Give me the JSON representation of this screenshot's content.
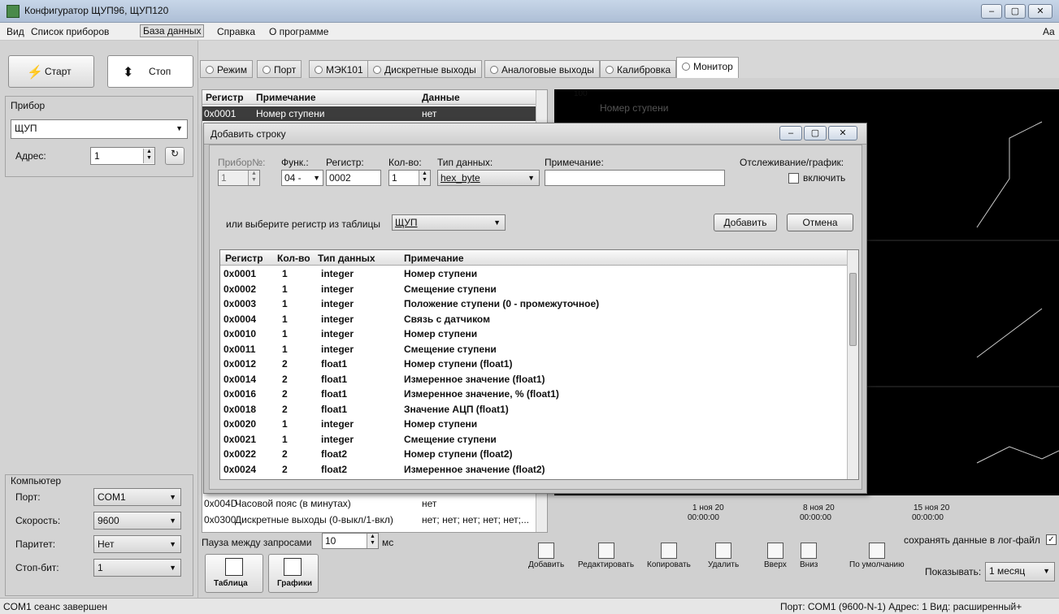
{
  "window": {
    "title": "Конфигуратор ЩУП96, ЩУП120",
    "min": "–",
    "max": "▢",
    "close": "✕"
  },
  "menu": {
    "items": [
      "Вид",
      "Список приборов",
      "База данных",
      "Справка",
      "О программе"
    ],
    "right": "Aa"
  },
  "controls": {
    "start_label": "Старт",
    "stop_label": "Стоп"
  },
  "device": {
    "group_label": "Прибор",
    "device_value": "ЩУП",
    "address_label": "Адрес:",
    "address_value": "1"
  },
  "computer": {
    "group_label": "Компьютер",
    "port_label": "Порт:",
    "port_value": "COM1",
    "speed_label": "Скорость:",
    "speed_value": "9600",
    "parity_label": "Паритет:",
    "parity_value": "Нет",
    "stopbit_label": "Стоп-бит:",
    "stopbit_value": "1"
  },
  "tabs": [
    "Режим",
    "Порт",
    "МЭК101",
    "Дискретные выходы",
    "Аналоговые выходы",
    "Калибровка",
    "Монитор"
  ],
  "active_tab": "Монитор",
  "reg_table": {
    "headers": [
      "Регистр",
      "Примечание",
      "Данные"
    ],
    "rows": [
      {
        "reg": "0x0001",
        "note": "Номер ступени",
        "data": "нет"
      },
      {
        "reg": "0x004D",
        "note": "Часовой пояс (в минутах)",
        "data": "нет"
      },
      {
        "reg": "0x0300",
        "note": "Дискретные выходы (0-выкл/1-вкл)",
        "data": "нет; нет; нет; нет; нет;..."
      }
    ]
  },
  "monitor": {
    "top_tick": "100",
    "chart_label": "Номер ступени",
    "x_ticks": [
      {
        "date": "1 ноя 20",
        "time": "00:00:00"
      },
      {
        "date": "8 ноя 20",
        "time": "00:00:00"
      },
      {
        "date": "15 ноя 20",
        "time": "00:00:00"
      }
    ]
  },
  "pause": {
    "label": "Пауза между запросами",
    "value": "10",
    "unit": "мс"
  },
  "log": {
    "label": "сохранять данные в лог-файл",
    "checked": true
  },
  "view_buttons": {
    "table": "Таблица",
    "charts": "Графики"
  },
  "toolbar": {
    "add": "Добавить",
    "edit": "Редактировать",
    "copy": "Копировать",
    "delete": "Удалить",
    "up": "Вверх",
    "down": "Вниз",
    "default": "По умолчанию",
    "show_label": "Показывать:",
    "show_value": "1 месяц"
  },
  "dialog": {
    "title": "Добавить строку",
    "device_no_label": "Прибор№:",
    "device_no_value": "1",
    "func_label": "Функ.:",
    "func_value": "04 -",
    "register_label": "Регистр:",
    "register_value": "0002",
    "count_label": "Кол-во:",
    "count_value": "1",
    "dtype_label": "Тип данных:",
    "dtype_value": "hex_byte",
    "note_label": "Примечание:",
    "note_value": "",
    "track_label": "Отслеживание/график:",
    "track_checkbox_label": "включить",
    "choose_label": "или выберите регистр из таблицы",
    "choose_value": "ЩУП",
    "add_button": "Добавить",
    "cancel_button": "Отмена",
    "list_headers": [
      "Регистр",
      "Кол-во",
      "Тип данных",
      "Примечание"
    ],
    "rows": [
      {
        "reg": "0x0001",
        "cnt": "1",
        "type": "integer",
        "note": "Номер ступени"
      },
      {
        "reg": "0x0002",
        "cnt": "1",
        "type": "integer",
        "note": "Смещение ступени"
      },
      {
        "reg": "0x0003",
        "cnt": "1",
        "type": "integer",
        "note": "Положение ступени (0 - промежуточное)"
      },
      {
        "reg": "0x0004",
        "cnt": "1",
        "type": "integer",
        "note": "Связь с датчиком"
      },
      {
        "reg": "0x0010",
        "cnt": "1",
        "type": "integer",
        "note": "Номер ступени"
      },
      {
        "reg": "0x0011",
        "cnt": "1",
        "type": "integer",
        "note": "Смещение ступени"
      },
      {
        "reg": "0x0012",
        "cnt": "2",
        "type": "float1",
        "note": "Номер ступени (float1)"
      },
      {
        "reg": "0x0014",
        "cnt": "2",
        "type": "float1",
        "note": "Измеренное значение (float1)"
      },
      {
        "reg": "0x0016",
        "cnt": "2",
        "type": "float1",
        "note": "Измеренное значение, % (float1)"
      },
      {
        "reg": "0x0018",
        "cnt": "2",
        "type": "float1",
        "note": "Значение АЦП (float1)"
      },
      {
        "reg": "0x0020",
        "cnt": "1",
        "type": "integer",
        "note": "Номер ступени"
      },
      {
        "reg": "0x0021",
        "cnt": "1",
        "type": "integer",
        "note": "Смещение ступени"
      },
      {
        "reg": "0x0022",
        "cnt": "2",
        "type": "float2",
        "note": "Номер ступени (float2)"
      },
      {
        "reg": "0x0024",
        "cnt": "2",
        "type": "float2",
        "note": "Измеренное значение (float2)"
      }
    ]
  },
  "status": {
    "left": "COM1 сеанс завершен",
    "right": "Порт: COM1 (9600-N-1)  Адрес: 1  Вид: расширенный+"
  }
}
